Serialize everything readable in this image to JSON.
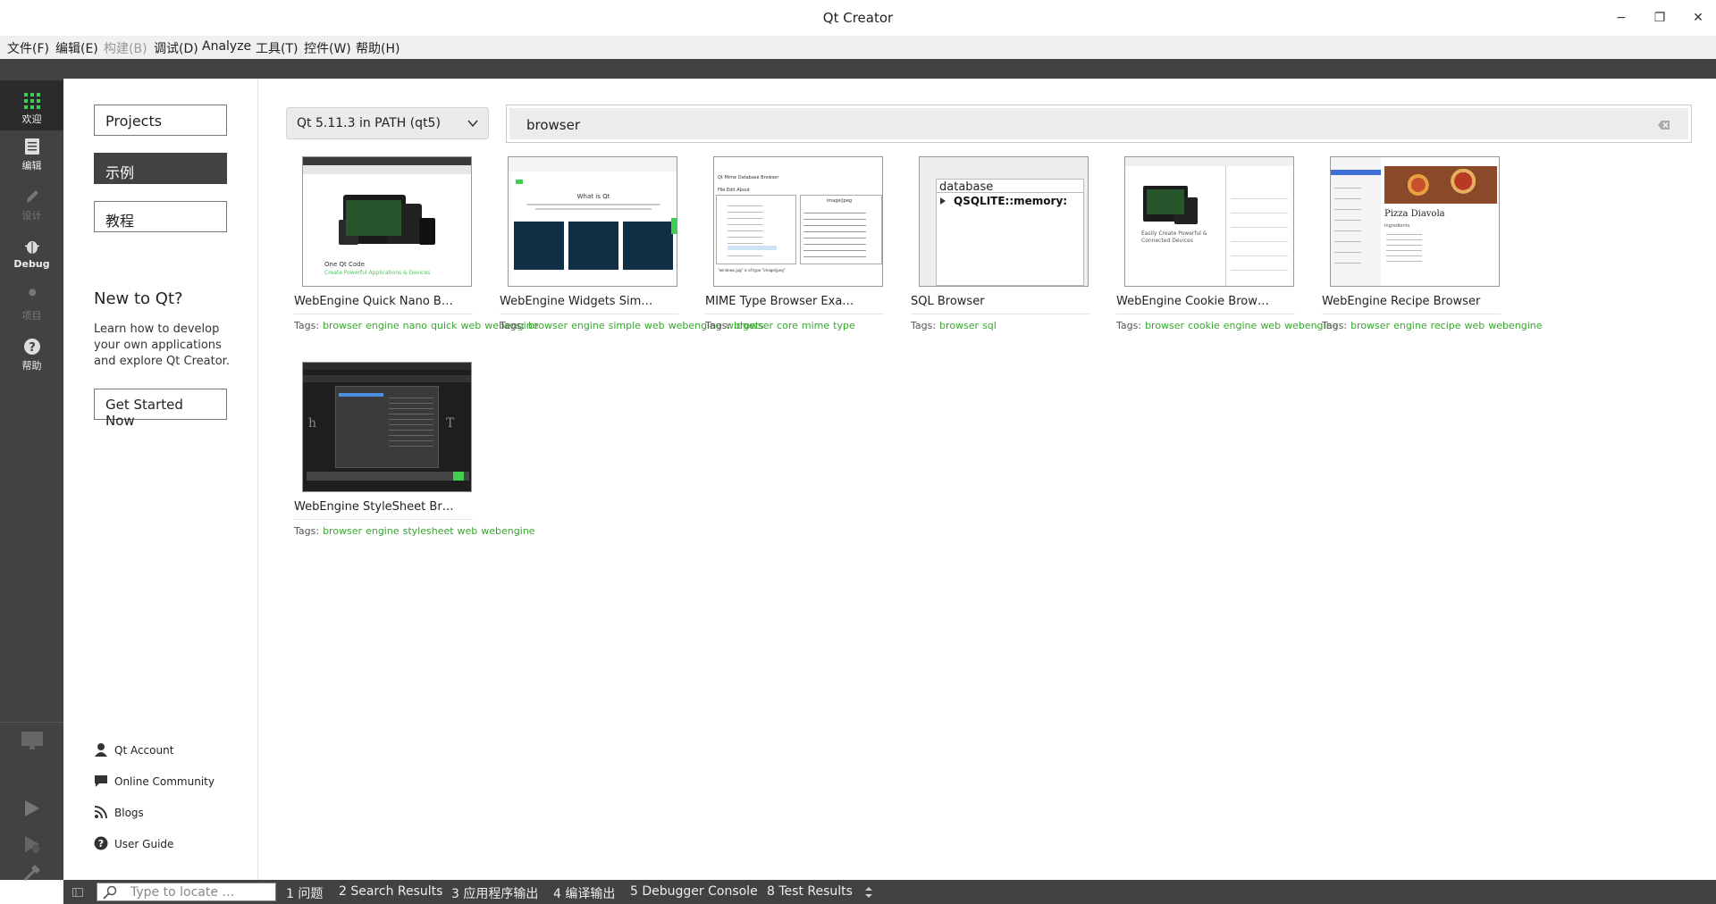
{
  "window": {
    "title": "Qt Creator",
    "minimize": "−",
    "maximize": "❐",
    "close": "✕"
  },
  "menu": [
    "文件(F)",
    "编辑(E)",
    "构建(B)",
    "调试(D)",
    "Analyze",
    "工具(T)",
    "控件(W)",
    "帮助(H)"
  ],
  "modes": {
    "welcome": "欢迎",
    "edit": "编辑",
    "design": "设计",
    "debug": "Debug",
    "projects": "项目",
    "help": "帮助"
  },
  "left": {
    "projects": "Projects",
    "examples": "示例",
    "tutorials": "教程",
    "new_to_qt": "New to Qt?",
    "learn": "Learn how to develop your own applications and explore Qt Creator.",
    "get_started": "Get Started Now",
    "links": [
      "Qt Account",
      "Online Community",
      "Blogs",
      "User Guide"
    ]
  },
  "qt_version": "Qt 5.11.3 in PATH (qt5)",
  "search_value": "browser",
  "tags_label": "Tags:",
  "examples": [
    {
      "title": "WebEngine Quick Nano B…",
      "tags": [
        "browser",
        "engine",
        "nano",
        "quick",
        "web",
        "webengine"
      ],
      "thumb": {
        "caption": "One Qt Code",
        "sub": "Create Powerful Applications & Devices"
      }
    },
    {
      "title": "WebEngine Widgets Sim…",
      "tags": [
        "browser",
        "engine",
        "simple",
        "web",
        "webengine",
        "widgets"
      ],
      "thumb": {
        "caption": "What is Qt"
      }
    },
    {
      "title": "MIME Type Browser Exa…",
      "tags": [
        "browser",
        "core",
        "mime",
        "type"
      ],
      "thumb": {
        "caption": "Qt Mime Database Browser",
        "menu": "File Edit About",
        "mime": "image/jpeg",
        "status": "\"windows.jpg\" is of type \"image/jpeg\""
      }
    },
    {
      "title": "SQL Browser",
      "tags": [
        "browser",
        "sql"
      ],
      "thumb": {
        "caption": "database",
        "sub": "QSQLITE::memory:"
      }
    },
    {
      "title": "WebEngine Cookie Brow…",
      "tags": [
        "browser",
        "cookie",
        "engine",
        "web",
        "webengine"
      ],
      "thumb": {
        "caption": "Easily Create Powerful & Connected Devices"
      }
    },
    {
      "title": "WebEngine Recipe Browser",
      "tags": [
        "browser",
        "engine",
        "recipe",
        "web",
        "webengine"
      ],
      "thumb": {
        "caption": "Pizza Diavola",
        "sub": "Ingredients"
      }
    },
    {
      "title": "WebEngine StyleSheet Br…",
      "tags": [
        "browser",
        "engine",
        "stylesheet",
        "web",
        "webengine"
      ],
      "thumb": {}
    }
  ],
  "status": {
    "locate_placeholder": "Type to locate …",
    "panes": [
      "1  问题",
      "2  Search Results",
      "3  应用程序输出",
      "4  编译输出",
      "5  Debugger Console",
      "8  Test Results"
    ]
  },
  "colors": {
    "tag": "#37a52e",
    "modebar": "#404244",
    "accent": "#41cd52"
  }
}
